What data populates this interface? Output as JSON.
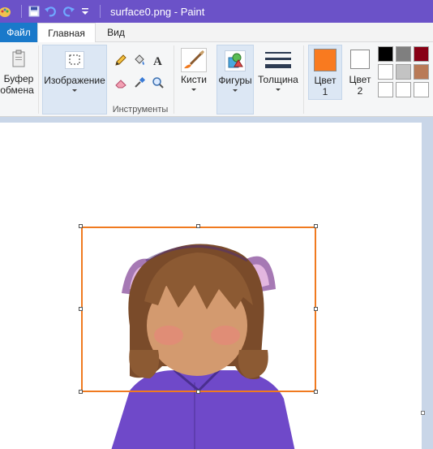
{
  "window": {
    "title": "surface0.png - Paint"
  },
  "tabs": {
    "file": "Файл",
    "home": "Главная",
    "view": "Вид"
  },
  "ribbon": {
    "clipboard": {
      "label_line1": "Буфер",
      "label_line2": "обмена"
    },
    "image": {
      "label": "Изображение"
    },
    "tools": {
      "group_label": "Инструменты"
    },
    "brushes": {
      "label": "Кисти"
    },
    "shapes": {
      "label": "Фигуры"
    },
    "size": {
      "label": "Толщина"
    },
    "color1": {
      "label_line1": "Цвет",
      "label_line2": "1",
      "color": "#f97a1f"
    },
    "color2": {
      "label_line1": "Цвет",
      "label_line2": "2",
      "color": "#ffffff"
    },
    "palette": [
      "#000000",
      "#7f7f7f",
      "#880015",
      "#ffffff",
      "#c3c3c3",
      "#b97a57",
      "#ffffff",
      "#ffffff",
      "#ffffff"
    ]
  },
  "colors": {
    "title_bar": "#6b52c8",
    "file_tab": "#1979ca",
    "selection_border": "#f07a1f"
  }
}
